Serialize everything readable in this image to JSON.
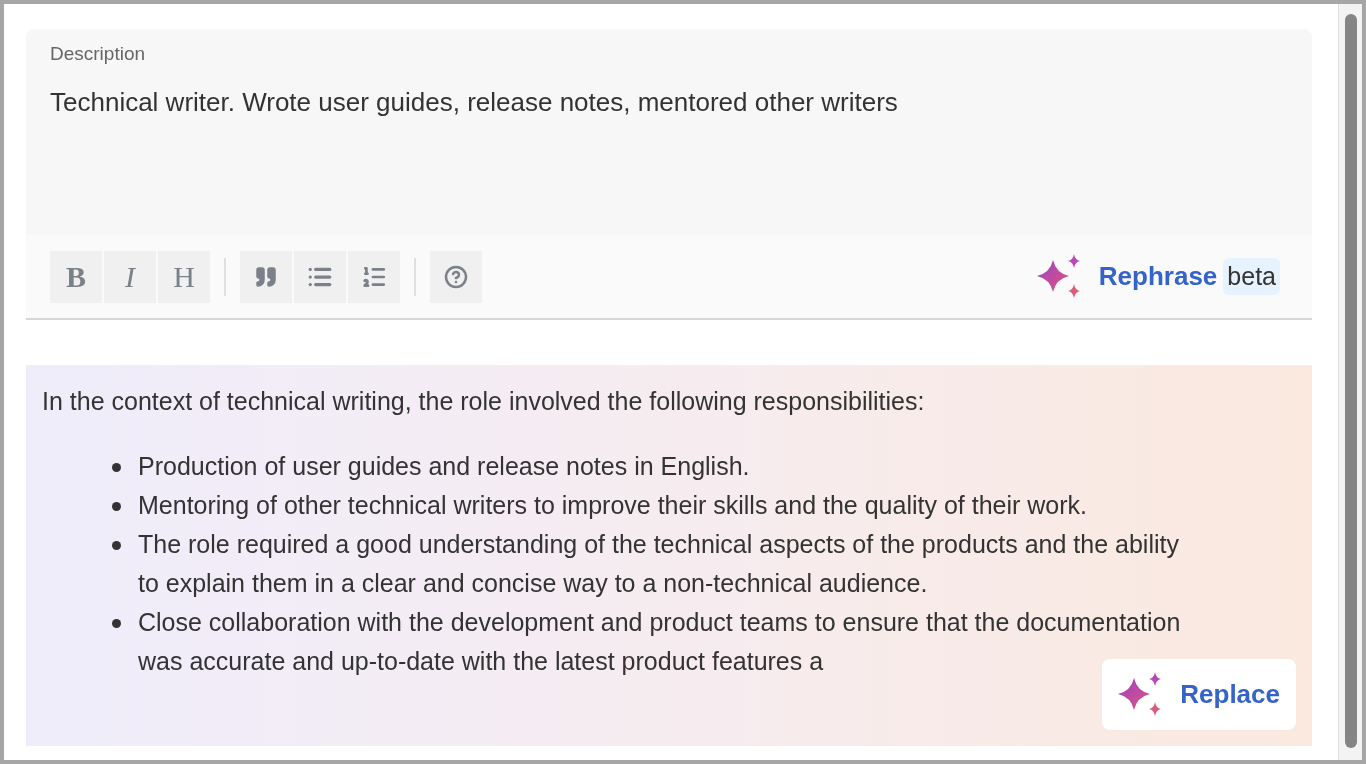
{
  "description": {
    "label": "Description",
    "value": "Technical writer. Wrote user guides, release notes, mentored other writers"
  },
  "toolbar": {
    "groups": [
      [
        {
          "kind": "bold",
          "label": "B"
        },
        {
          "kind": "italic",
          "label": "I"
        },
        {
          "kind": "heading",
          "label": "H"
        }
      ],
      [
        {
          "kind": "quote"
        },
        {
          "kind": "bullets"
        },
        {
          "kind": "numbers"
        }
      ],
      [
        {
          "kind": "help"
        }
      ]
    ],
    "rephrase": {
      "label": "Rephrase",
      "badge": "beta"
    }
  },
  "result": {
    "intro": "In the context of technical writing, the role involved the following responsibilities:",
    "items": [
      "Production of user guides and release notes in English.",
      "Mentoring of other technical writers to improve their skills and the quality of their work.",
      "The role required a good understanding of the technical aspects of the products and the ability to explain them in a clear and concise way to a non-technical audience.",
      "Close collaboration with the development and product teams to ensure that the documentation was accurate and up-to-date with the latest product features a"
    ],
    "button": "Replace"
  }
}
